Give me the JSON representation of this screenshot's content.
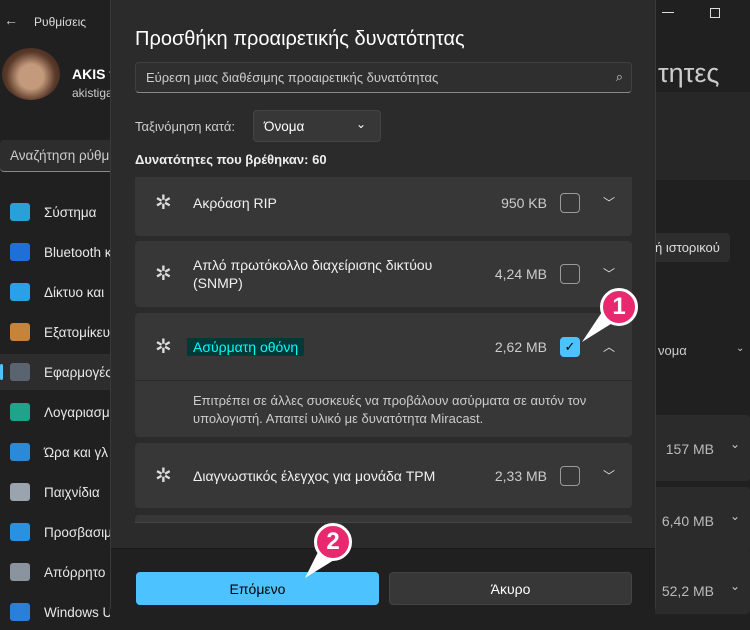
{
  "window": {
    "back_icon": "arrow-left-icon",
    "title": "Ρυθμίσεις",
    "minimize_icon": "minimize-icon",
    "maximize_icon": "maximize-icon"
  },
  "user": {
    "name": "AKIS t",
    "email": "akistiga"
  },
  "sidebar": {
    "search_placeholder": "Αναζήτηση ρύθμ",
    "items": [
      {
        "label": "Σύστημα",
        "icon": "system-icon",
        "color": "#2aa0d8"
      },
      {
        "label": "Bluetooth κ",
        "icon": "bluetooth-icon",
        "color": "#1f6fd8"
      },
      {
        "label": "Δίκτυο και",
        "icon": "wifi-icon",
        "color": "#2aa0e8"
      },
      {
        "label": "Εξατομίκευ",
        "icon": "brush-icon",
        "color": "#c8833a"
      },
      {
        "label": "Εφαρμογές",
        "icon": "apps-icon",
        "color": "#5a6470",
        "active": true
      },
      {
        "label": "Λογαριασμ",
        "icon": "account-icon",
        "color": "#1fa38a"
      },
      {
        "label": "Ώρα και γλ",
        "icon": "time-language-icon",
        "color": "#2a8ad8"
      },
      {
        "label": "Παιχνίδια",
        "icon": "gamepad-icon",
        "color": "#9aa4ae"
      },
      {
        "label": "Προσβασιμ",
        "icon": "accessibility-icon",
        "color": "#2a90e0"
      },
      {
        "label": "Απόρρητο",
        "icon": "shield-icon",
        "color": "#8a949e"
      },
      {
        "label": "Windows U",
        "icon": "update-icon",
        "color": "#2a80d8"
      }
    ]
  },
  "background": {
    "page_title_fragment": "τητες",
    "history_button": "ή ιστορικού",
    "sort_value": "νομα",
    "sizes": [
      "157 MB",
      "6,40 MB",
      "52,2 MB"
    ]
  },
  "dialog": {
    "title": "Προσθήκη προαιρετικής δυνατότητας",
    "search_placeholder": "Εύρεση μιας διαθέσιμης προαιρετικής δυνατότητας",
    "sort_label": "Ταξινόμηση κατά:",
    "sort_value": "Όνομα",
    "found": "Δυνατότητες που βρέθηκαν: 60",
    "features": [
      {
        "name": "Ακρόαση RIP",
        "size": "950 KB",
        "checked": false,
        "expanded": false
      },
      {
        "name": "Απλό πρωτόκολλο διαχείρισης δικτύου (SNMP)",
        "size": "4,24 MB",
        "checked": false,
        "expanded": false
      },
      {
        "name": "Ασύρματη οθόνη",
        "size": "2,62 MB",
        "checked": true,
        "expanded": true,
        "description": "Επιτρέπει σε άλλες συσκευές να προβάλουν ασύρματα σε αυτόν τον υπολογιστή. Απαιτεί υλικό με δυνατότητα Miracast."
      },
      {
        "name": "Διαγνωστικός έλεγχος για μονάδα TPM",
        "size": "2,33 MB",
        "checked": false,
        "expanded": false
      }
    ],
    "next_button": "Επόμενο",
    "cancel_button": "Άκυρο",
    "accent": "#4cc2ff",
    "highlight": "#00ffff"
  },
  "annotations": [
    "1",
    "2"
  ]
}
